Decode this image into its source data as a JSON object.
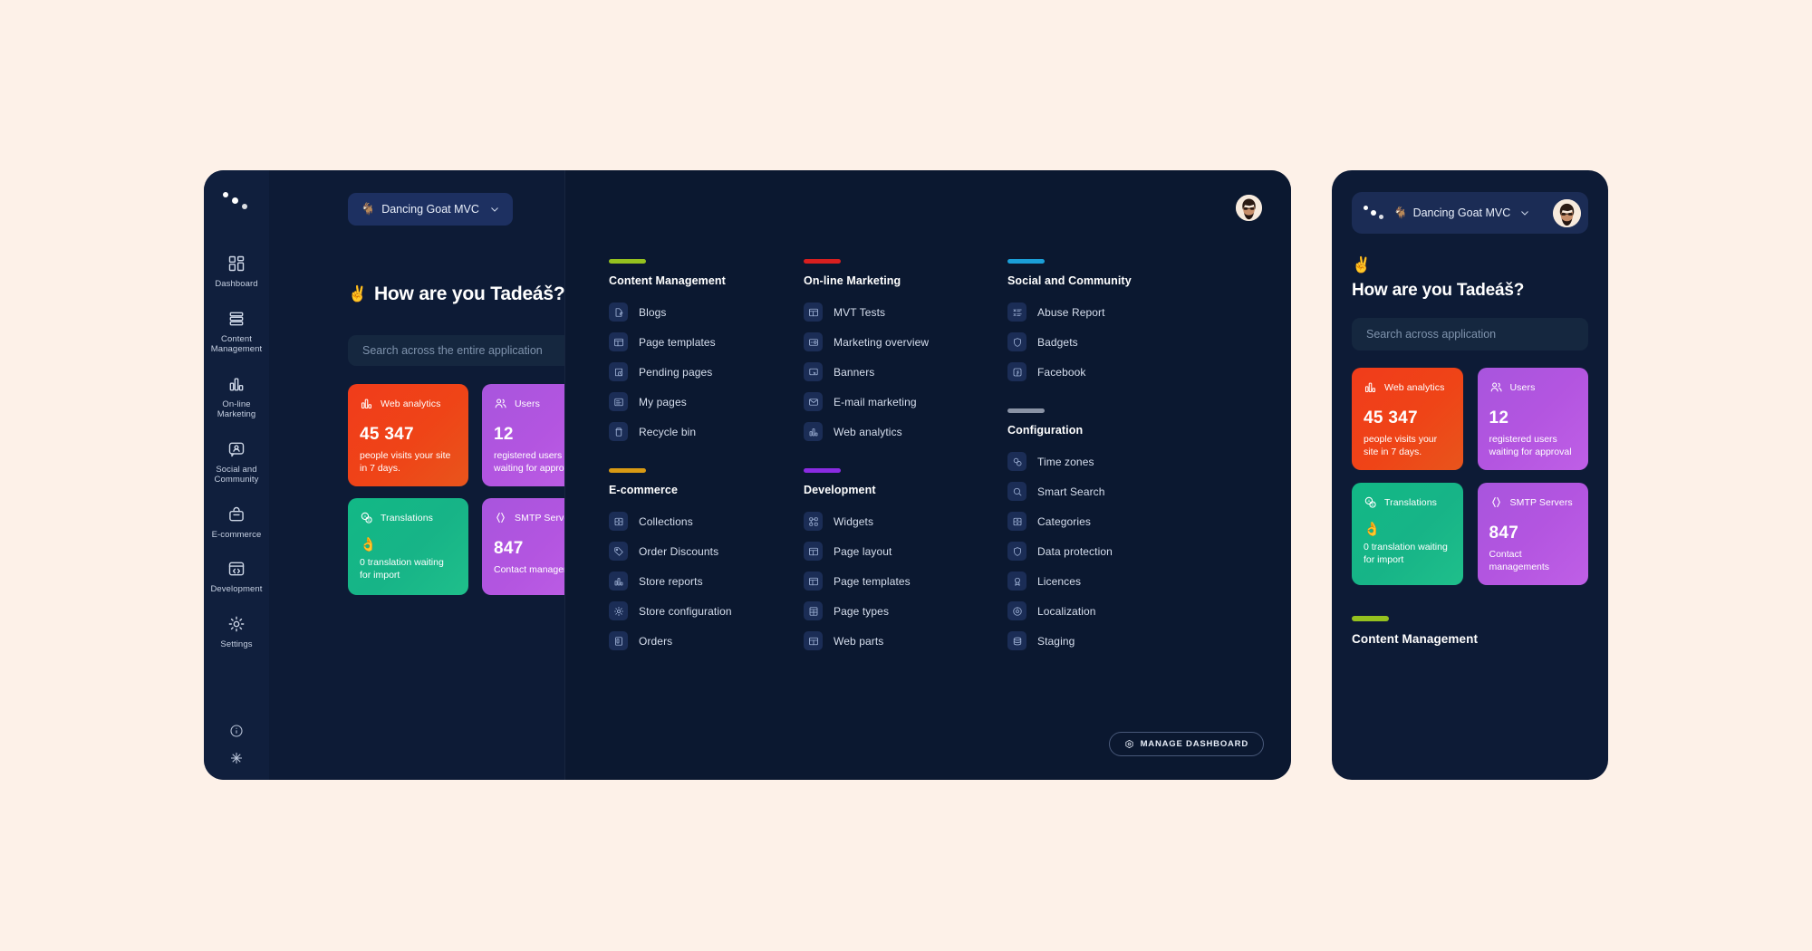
{
  "brand": {
    "name": "Dancing Goat MVC",
    "goat_emoji": "🐐",
    "chevron_icon": "chevron-down-icon"
  },
  "sidebar": {
    "logo": "kentico-dots-logo",
    "items": [
      {
        "label": "Dashboard",
        "icon": "dashboard-grid-icon"
      },
      {
        "label": "Content Management",
        "icon": "content-stack-icon"
      },
      {
        "label": "On-line Marketing",
        "icon": "bar-chart-icon"
      },
      {
        "label": "Social and Community",
        "icon": "chat-user-icon"
      },
      {
        "label": "E-commerce",
        "icon": "shopping-bag-icon"
      },
      {
        "label": "Development",
        "icon": "code-window-icon"
      },
      {
        "label": "Settings",
        "icon": "gear-icon"
      }
    ],
    "bottom": [
      {
        "icon": "info-circle-icon"
      },
      {
        "icon": "snowflake-icon"
      }
    ]
  },
  "hero": {
    "emoji": "✌️",
    "greeting": "How are you Tadeáš?"
  },
  "search": {
    "placeholder": "Search across the entire application"
  },
  "tiles": [
    {
      "name": "Web analytics",
      "icon": "bar-chart-icon",
      "value": "45 347",
      "description": "people visits your site in 7 days.",
      "theme": "orange",
      "color": "#ef3b17"
    },
    {
      "name": "Users",
      "icon": "users-icon",
      "value": "12",
      "description": "registered users waiting for approval",
      "theme": "purple",
      "color": "#b357e1"
    },
    {
      "name": "Translations",
      "icon": "translate-icon",
      "emoji": "👌",
      "description": "0 translation waiting for import",
      "theme": "green",
      "color": "#16b687"
    },
    {
      "name": "SMTP Servers",
      "icon": "code-brackets-icon",
      "value": "847",
      "description": "Contact managements",
      "theme": "purple",
      "color": "#b357e1"
    }
  ],
  "menu_groups": [
    {
      "title": "Content Management",
      "accent": "#95c11f",
      "column": 0,
      "items": [
        {
          "label": "Blogs",
          "icon": "blog-pencil-icon"
        },
        {
          "label": "Page templates",
          "icon": "page-template-icon"
        },
        {
          "label": "Pending pages",
          "icon": "pending-clock-icon"
        },
        {
          "label": "My pages",
          "icon": "my-pages-icon"
        },
        {
          "label": "Recycle bin",
          "icon": "trash-icon"
        }
      ]
    },
    {
      "title": "E-commerce",
      "accent": "#d89a14",
      "column": 0,
      "items": [
        {
          "label": "Collections",
          "icon": "collections-icon"
        },
        {
          "label": "Order Discounts",
          "icon": "tag-icon"
        },
        {
          "label": "Store reports",
          "icon": "bar-chart-icon"
        },
        {
          "label": "Store configuration",
          "icon": "gear-icon"
        },
        {
          "label": "Orders",
          "icon": "orders-icon"
        }
      ]
    },
    {
      "title": "On-line Marketing",
      "accent": "#d81f1f",
      "column": 1,
      "items": [
        {
          "label": "MVT Tests",
          "icon": "mvt-layout-icon"
        },
        {
          "label": "Marketing overview",
          "icon": "marketing-overview-icon"
        },
        {
          "label": "Banners",
          "icon": "banner-cursor-icon"
        },
        {
          "label": "E-mail marketing",
          "icon": "envelope-icon"
        },
        {
          "label": "Web analytics",
          "icon": "bar-chart-icon"
        }
      ]
    },
    {
      "title": "Development",
      "accent": "#8a2be2",
      "column": 1,
      "items": [
        {
          "label": "Widgets",
          "icon": "widgets-icon"
        },
        {
          "label": "Page layout",
          "icon": "page-layout-icon"
        },
        {
          "label": "Page templates",
          "icon": "page-template-icon"
        },
        {
          "label": "Page types",
          "icon": "page-types-icon"
        },
        {
          "label": "Web parts",
          "icon": "web-parts-icon"
        }
      ]
    },
    {
      "title": "Social and Community",
      "accent": "#1b9fd8",
      "column": 2,
      "items": [
        {
          "label": "Abuse Report",
          "icon": "abuse-report-icon"
        },
        {
          "label": "Badgets",
          "icon": "shield-icon"
        },
        {
          "label": "Facebook",
          "icon": "facebook-icon"
        }
      ]
    },
    {
      "title": "Configuration",
      "accent": "#8a93a5",
      "column": 2,
      "items": [
        {
          "label": "Time zones",
          "icon": "time-zones-icon"
        },
        {
          "label": "Smart Search",
          "icon": "search-icon"
        },
        {
          "label": "Categories",
          "icon": "categories-icon"
        },
        {
          "label": "Data protection",
          "icon": "shield-icon"
        },
        {
          "label": "Licences",
          "icon": "licence-badge-icon"
        },
        {
          "label": "Localization",
          "icon": "localization-pin-icon"
        },
        {
          "label": "Staging",
          "icon": "staging-layers-icon"
        }
      ]
    }
  ],
  "manage_dashboard": {
    "label": "MANAGE DASHBOARD",
    "icon": "settings-hex-icon"
  },
  "mobile": {
    "search": {
      "placeholder": "Search across application"
    },
    "footer_group": {
      "title": "Content Management",
      "accent": "#95c11f"
    }
  },
  "avatar": {
    "name": "user-avatar"
  }
}
